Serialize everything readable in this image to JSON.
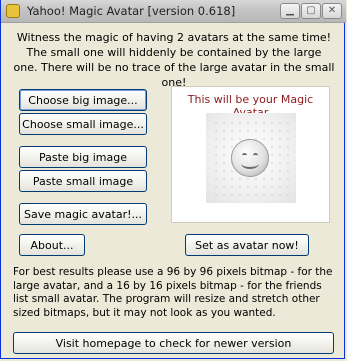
{
  "window": {
    "title": "Yahoo! Magic Avatar [version 0.618]",
    "minimize_icon": "minimize-icon",
    "maximize_icon": "maximize-icon",
    "close_icon": "close-icon"
  },
  "intro_text": "Witness the magic of having 2 avatars at the same time! The small one will hiddenly be contained by the large one. There will be no trace of the large avatar in the small one!",
  "buttons": {
    "choose_big": "Choose big image...",
    "choose_small": "Choose small image...",
    "paste_big": "Paste big image",
    "paste_small": "Paste small image",
    "save": "Save magic avatar!...",
    "about": "About...",
    "set_avatar": "Set as avatar now!",
    "visit_homepage": "Visit homepage to check for newer version"
  },
  "preview": {
    "title": "This will be your Magic Avatar",
    "image_icon": "smiley-avatar-icon"
  },
  "footnote": "For best results please use a 96 by 96 pixels bitmap - for the large avatar, and a 16 by 16 pixels bitmap - for the friends list small avatar. The program will resize and stretch other sized bitmaps, but it may not look as you wanted.",
  "colors": {
    "window_bg": "#ece9d8",
    "panel_title": "#8b1a1a",
    "button_border": "#003c74"
  }
}
